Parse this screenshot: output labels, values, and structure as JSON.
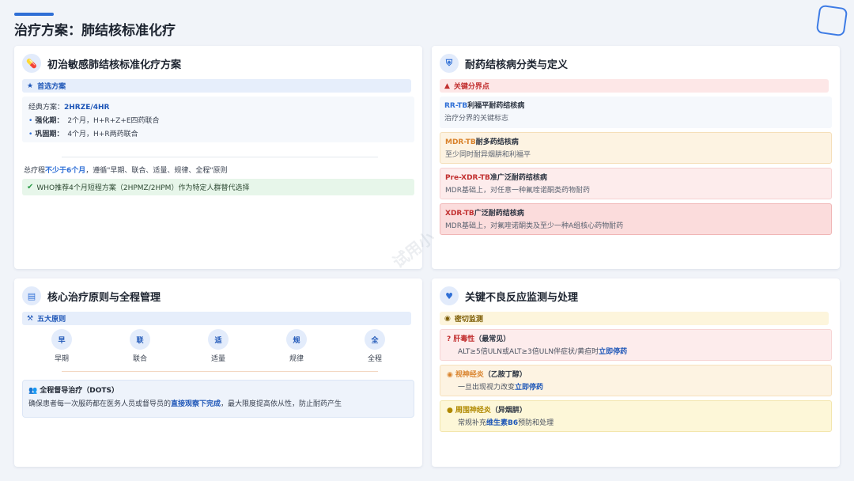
{
  "page": {
    "title": "治疗方案：肺结核标准化疗",
    "watermark": "试用小"
  },
  "colors": {
    "primary": "#2f6fd6",
    "danger": "#c23030",
    "warning": "#d9822b",
    "success": "#2e9d4a"
  },
  "tl": {
    "title": "初治敏感肺结核标准化疗方案",
    "icon": "pills-icon",
    "strip": "首选方案",
    "scheme_label": "经典方案：",
    "scheme_value": "2HRZE/4HR",
    "phase1_label": "强化期：",
    "phase1_text": "2个月，H+R+Z+E四药联合",
    "phase2_label": "巩固期：",
    "phase2_text": "4个月，H+R两药联合",
    "course_pre": "总疗程",
    "course_hl": "不少于6个月",
    "course_post": "，遵循\"早期、联合、适量、规律、全程\"原则",
    "who_text": "WHO推荐4个月短程方案（2HPMZ/2HPM）作为特定人群替代选择"
  },
  "tr": {
    "title": "耐药结核病分类与定义",
    "icon": "shield-icon",
    "strip": "关键分界点",
    "items": [
      {
        "code": "RR-TB",
        "name": "利福平耐药结核病",
        "desc": "治疗分界的关键标志"
      },
      {
        "code": "MDR-TB",
        "name": "耐多药结核病",
        "desc": "至少同时耐异烟肼和利福平"
      },
      {
        "code": "Pre-XDR-TB",
        "name": "准广泛耐药结核病",
        "desc": "MDR基础上，对任意一种氟喹诺酮类药物耐药"
      },
      {
        "code": "XDR-TB",
        "name": "广泛耐药结核病",
        "desc": "MDR基础上，对氟喹诺酮类及至少一种A组核心药物耐药"
      }
    ]
  },
  "bl": {
    "title": "核心治疗原则与全程管理",
    "icon": "clipboard-icon",
    "strip": "五大原则",
    "principles": [
      {
        "char": "早",
        "label": "早期"
      },
      {
        "char": "联",
        "label": "联合"
      },
      {
        "char": "适",
        "label": "适量"
      },
      {
        "char": "规",
        "label": "规律"
      },
      {
        "char": "全",
        "label": "全程"
      }
    ],
    "dots_title": "全程督导治疗（DOTS）",
    "dots_pre": "确保患者每一次服药都在医务人员或督导员的",
    "dots_hl": "直接观察下完成",
    "dots_post": "，最大限度提高依从性，防止耐药产生"
  },
  "br": {
    "title": "关键不良反应监测与处理",
    "icon": "heart-pulse-icon",
    "strip": "密切监测",
    "items": [
      {
        "name": "肝毒性",
        "note": "（最常见）",
        "desc_pre": "ALT≥5倍ULN或ALT≥3倍ULN伴症状/黄疸时",
        "desc_hl": "立即停药",
        "desc_post": ""
      },
      {
        "name": "视神经炎",
        "note": "（乙胺丁醇）",
        "desc_pre": "一旦出现视力改变",
        "desc_hl": "立即停药",
        "desc_post": ""
      },
      {
        "name": "周围神经炎",
        "note": "（异烟肼）",
        "desc_pre": "常规补充",
        "desc_hl": "维生素B6",
        "desc_post": "预防和处理"
      }
    ]
  }
}
